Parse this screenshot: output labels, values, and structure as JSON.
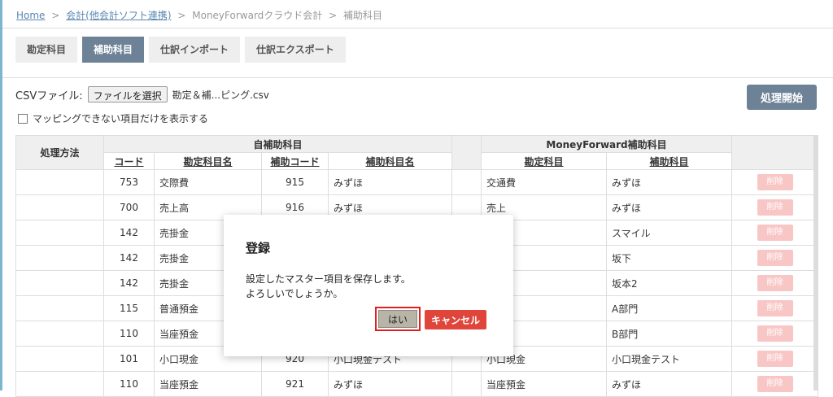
{
  "breadcrumb": {
    "home": "Home",
    "link": "会計(他会計ソフト連携)",
    "crumb3": "MoneyForwardクラウド会計",
    "current": "補助科目",
    "sep": ">"
  },
  "tabs": [
    {
      "label": "勘定科目",
      "active": false
    },
    {
      "label": "補助科目",
      "active": true
    },
    {
      "label": "仕訳インポート",
      "active": false
    },
    {
      "label": "仕訳エクスポート",
      "active": false
    }
  ],
  "csv": {
    "label": "CSVファイル:",
    "choose_button": "ファイルを選択",
    "file_name": "勘定＆補...ピング.csv"
  },
  "start_button": "処理開始",
  "checkbox_label": "マッピングできない項目だけを表示する",
  "table": {
    "group_header_process": "処理方法",
    "group_header_own": "自補助科目",
    "group_header_mf": "MoneyForward補助科目",
    "columns": {
      "code": "コード",
      "account_name": "勘定科目名",
      "sub_code": "補助コード",
      "sub_name": "補助科目名",
      "mf_account": "勘定科目",
      "mf_sub": "補助科目"
    },
    "delete_label": "削除",
    "rows": [
      {
        "code": "753",
        "account": "交際費",
        "sub_code": "915",
        "sub_name": "みずほ",
        "mf_account": "交通費",
        "mf_sub": "みずほ"
      },
      {
        "code": "700",
        "account": "売上高",
        "sub_code": "916",
        "sub_name": "みずほ",
        "mf_account": "売上",
        "mf_sub": "みずほ"
      },
      {
        "code": "142",
        "account": "売掛金",
        "sub_code": "",
        "sub_name": "",
        "mf_account": "",
        "mf_sub": "スマイル"
      },
      {
        "code": "142",
        "account": "売掛金",
        "sub_code": "",
        "sub_name": "",
        "mf_account": "",
        "mf_sub": "坂下"
      },
      {
        "code": "142",
        "account": "売掛金",
        "sub_code": "",
        "sub_name": "",
        "mf_account": "",
        "mf_sub": "坂本2"
      },
      {
        "code": "115",
        "account": "普通預金",
        "sub_code": "",
        "sub_name": "",
        "mf_account": "",
        "mf_sub": "A部門"
      },
      {
        "code": "110",
        "account": "当座預金",
        "sub_code": "",
        "sub_name": "",
        "mf_account": "",
        "mf_sub": "B部門"
      },
      {
        "code": "101",
        "account": "小口現金",
        "sub_code": "920",
        "sub_name": "小口現金テスト",
        "mf_account": "小口現金",
        "mf_sub": "小口現金テスト"
      },
      {
        "code": "110",
        "account": "当座預金",
        "sub_code": "921",
        "sub_name": "みずほ",
        "mf_account": "当座預金",
        "mf_sub": "みずほ"
      }
    ]
  },
  "dialog": {
    "title": "登録",
    "message_line1": "設定したマスター項目を保存します。",
    "message_line2": "よろしいでしょうか。",
    "yes": "はい",
    "cancel": "キャンセル"
  },
  "colors": {
    "accent": "#6d8297",
    "cancel": "#e0453b",
    "highlight": "#e02020"
  }
}
